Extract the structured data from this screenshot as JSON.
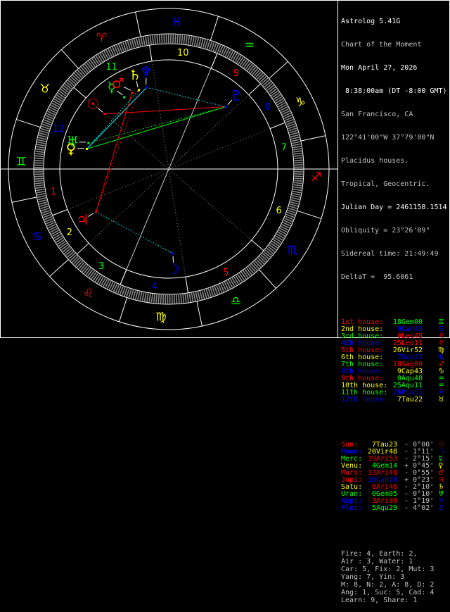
{
  "colors": {
    "red": "#ff0000",
    "yellow": "#ffff00",
    "green": "#00ff00",
    "blue": "#0000ff",
    "cyan": "#00ffff",
    "grey": "#a0a0a0",
    "white": "#ffffff"
  },
  "header": {
    "app_title": "Astrolog 5.41G",
    "chart_name": "Chart of the Moment",
    "date": "Mon April 27, 2026",
    "time": " 8:38:00am (DT -8:00 GMT)",
    "location": "San Francisco, CA",
    "coords": "122°41'00\"W 37°79'00\"N",
    "house_system": "Placidus houses.",
    "zodiac": "Tropical, Geocentric.",
    "julian_day": "Julian Day = 2461158.1514",
    "obliquity": "Obliquity = 23°26'09\"",
    "sidereal": "Sidereal time: 21:49:49",
    "deltat": "DeltaT =  95.6061"
  },
  "houses": [
    {
      "label": "1st house:",
      "value": "18Gem00",
      "sign": "gemini",
      "color": "red",
      "vcolor": "green",
      "lon": 78.0
    },
    {
      "label": "2nd house:",
      "value": "9Can43",
      "sign": "cancer",
      "color": "yellow",
      "vcolor": "blue",
      "lon": 99.72
    },
    {
      "label": "3rd house:",
      "value": "0Leo48",
      "sign": "leo",
      "color": "green",
      "vcolor": "red",
      "lon": 120.8
    },
    {
      "label": "4th house:",
      "value": "25Leo11",
      "sign": "leo",
      "color": "blue",
      "vcolor": "red",
      "lon": 145.18
    },
    {
      "label": "5th house:",
      "value": "26Vir52",
      "sign": "virgo",
      "color": "red",
      "vcolor": "yellow",
      "lon": 176.87
    },
    {
      "label": "6th house:",
      "value": "7Sco22",
      "sign": "scorpio",
      "color": "yellow",
      "vcolor": "blue",
      "lon": 217.37
    },
    {
      "label": "7th house:",
      "value": "18Sag00",
      "sign": "sagittarius",
      "color": "green",
      "vcolor": "red",
      "lon": 258.0
    },
    {
      "label": "8th house:",
      "value": "9Cap43",
      "sign": "capricorn",
      "color": "blue",
      "vcolor": "yellow",
      "lon": 279.72
    },
    {
      "label": "9th house:",
      "value": "0Aqu48",
      "sign": "aquarius",
      "color": "red",
      "vcolor": "green",
      "lon": 300.8
    },
    {
      "label": "10th house:",
      "value": "25Aqu11",
      "sign": "aquarius",
      "color": "yellow",
      "vcolor": "green",
      "lon": 325.18
    },
    {
      "label": "11th house:",
      "value": "26Pis52",
      "sign": "pisces",
      "color": "green",
      "vcolor": "blue",
      "lon": 356.87
    },
    {
      "label": "12th house:",
      "value": "7Tau22",
      "sign": "taurus",
      "color": "blue",
      "vcolor": "yellow",
      "lon": 37.37
    }
  ],
  "house_numbers": [
    "1",
    "2",
    "3",
    "4",
    "5",
    "6",
    "7",
    "8",
    "9",
    "10",
    "11",
    "12"
  ],
  "planets": [
    {
      "name": "Sun:",
      "value": "7Tau23",
      "vcolor": "yellow",
      "lat": "- 0°00'",
      "color": "red",
      "icon": "sun",
      "lon": 37.38
    },
    {
      "name": "Moon:",
      "value": "20Vir48",
      "vcolor": "yellow",
      "lat": "- 1°11'",
      "color": "blue",
      "icon": "moon",
      "lon": 170.8
    },
    {
      "name": "Merc:",
      "value": "19Ari53",
      "vcolor": "red",
      "lat": "- 2°15'",
      "color": "green",
      "icon": "mercury",
      "lon": 19.88
    },
    {
      "name": "Venu:",
      "value": "4Gem14",
      "vcolor": "green",
      "lat": "+ 0°45'",
      "color": "yellow",
      "icon": "venus",
      "lon": 64.23
    },
    {
      "name": "Mars:",
      "value": "13Ari48",
      "vcolor": "red",
      "lat": "- 0°55'",
      "color": "red",
      "icon": "mars",
      "lon": 13.8
    },
    {
      "name": "Jupi:",
      "value": "18Can28",
      "vcolor": "blue",
      "lat": "+ 0°23'",
      "color": "red",
      "icon": "jupiter",
      "lon": 108.47
    },
    {
      "name": "Satu:",
      "value": "8Ari46",
      "vcolor": "red",
      "lat": "- 2°10'",
      "color": "yellow",
      "icon": "saturn",
      "lon": 8.77
    },
    {
      "name": "Uran:",
      "value": "0Gem05",
      "vcolor": "green",
      "lat": "- 0°10'",
      "color": "green",
      "icon": "uranus",
      "lon": 60.08
    },
    {
      "name": "Nept:",
      "value": "3Ari09",
      "vcolor": "red",
      "lat": "- 1°19'",
      "color": "blue",
      "icon": "neptune",
      "lon": 3.15
    },
    {
      "name": "Plut:",
      "value": "5Aqu29",
      "vcolor": "green",
      "lat": "- 4°02'",
      "color": "blue",
      "icon": "pluto",
      "lon": 305.48
    }
  ],
  "signs": [
    {
      "icon": "aries",
      "color": "red"
    },
    {
      "icon": "taurus",
      "color": "yellow"
    },
    {
      "icon": "gemini",
      "color": "green"
    },
    {
      "icon": "cancer",
      "color": "blue"
    },
    {
      "icon": "leo",
      "color": "red"
    },
    {
      "icon": "virgo",
      "color": "yellow"
    },
    {
      "icon": "libra",
      "color": "green"
    },
    {
      "icon": "scorpio",
      "color": "blue"
    },
    {
      "icon": "sagittarius",
      "color": "red"
    },
    {
      "icon": "capricorn",
      "color": "yellow"
    },
    {
      "icon": "aquarius",
      "color": "green"
    },
    {
      "icon": "pisces",
      "color": "blue"
    }
  ],
  "aspects": [
    {
      "a": 0,
      "b": 9,
      "color": "red",
      "dotted": false
    },
    {
      "a": 3,
      "b": 9,
      "color": "green",
      "dotted": false
    },
    {
      "a": 3,
      "b": 8,
      "color": "cyan",
      "dotted": false
    },
    {
      "a": 8,
      "b": 9,
      "color": "cyan",
      "dotted": true
    },
    {
      "a": 5,
      "b": 4,
      "color": "red",
      "dotted": false
    },
    {
      "a": 5,
      "b": 6,
      "color": "red",
      "dotted": true
    },
    {
      "a": 5,
      "b": 1,
      "color": "cyan",
      "dotted": true
    },
    {
      "a": 7,
      "b": 9,
      "color": "green",
      "dotted": true
    },
    {
      "a": 3,
      "b": 6,
      "color": "cyan",
      "dotted": true
    }
  ],
  "stats": [
    "Fire: 4, Earth: 2,",
    "Air : 3, Water: 1",
    "Car: 5, Fix: 2, Mut: 3",
    "Yang: 7, Yin: 3",
    "M: 8, N: 2, A: 8, D: 2",
    "Ang: 1, Suc: 5, Cad: 4",
    "Learn: 9, Share: 1"
  ]
}
